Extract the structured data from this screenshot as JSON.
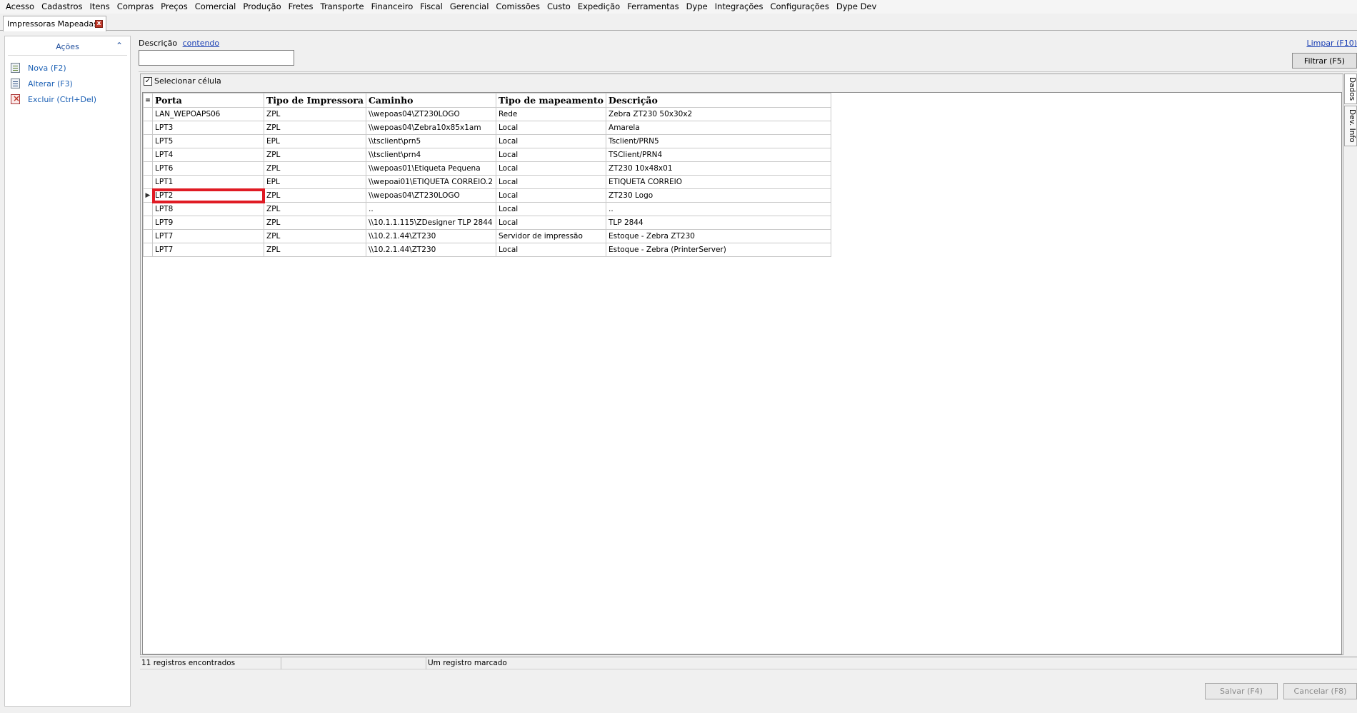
{
  "menu": [
    "Acesso",
    "Cadastros",
    "Itens",
    "Compras",
    "Preços",
    "Comercial",
    "Produção",
    "Fretes",
    "Transporte",
    "Financeiro",
    "Fiscal",
    "Gerencial",
    "Comissões",
    "Custo",
    "Expedição",
    "Ferramentas",
    "Dype",
    "Integrações",
    "Configurações",
    "Dype Dev"
  ],
  "tab": {
    "title": "Impressoras Mapeadas",
    "close_glyph": "x"
  },
  "actions": {
    "title": "Ações",
    "items": [
      {
        "label": "Nova (F2)",
        "icon": "new-document-icon"
      },
      {
        "label": "Alterar (F3)",
        "icon": "edit-document-icon"
      },
      {
        "label": "Excluir (Ctrl+Del)",
        "icon": "delete-document-icon"
      }
    ]
  },
  "filter": {
    "label": "Descrição",
    "mode_link": "contendo",
    "value": "",
    "clear_link": "Limpar (F10)",
    "filter_button": "Filtrar (F5)"
  },
  "grid": {
    "select_cell_label": "Selecionar célula",
    "select_cell_checked": true,
    "columns": [
      "Porta",
      "Tipo de Impressora",
      "Caminho",
      "Tipo de mapeamento",
      "Descrição"
    ],
    "rows": [
      [
        "LAN_WEPOAPS06",
        "ZPL",
        "\\\\wepoas04\\ZT230LOGO",
        "Rede",
        "Zebra ZT230 50x30x2"
      ],
      [
        "LPT3",
        "ZPL",
        "\\\\wepoas04\\Zebra10x85x1am",
        "Local",
        "Amarela"
      ],
      [
        "LPT5",
        "EPL",
        "\\\\tsclient\\prn5",
        "Local",
        "Tsclient/PRN5"
      ],
      [
        "LPT4",
        "ZPL",
        "\\\\tsclient\\prn4",
        "Local",
        "TSClient/PRN4"
      ],
      [
        "LPT6",
        "ZPL",
        "\\\\wepoas01\\Etiqueta Pequena",
        "Local",
        "ZT230 10x48x01"
      ],
      [
        "LPT1",
        "EPL",
        "\\\\wepoai01\\ETIQUETA CORREIO.2",
        "Local",
        "ETIQUETA CORREIO"
      ],
      [
        "LPT2",
        "ZPL",
        "\\\\wepoas04\\ZT230LOGO",
        "Local",
        "ZT230 Logo"
      ],
      [
        "LPT8",
        "ZPL",
        "..",
        "Local",
        ".."
      ],
      [
        "LPT9",
        "ZPL",
        "\\\\10.1.1.115\\ZDesigner TLP 2844",
        "Local",
        "TLP 2844"
      ],
      [
        "LPT7",
        "ZPL",
        "\\\\10.2.1.44\\ZT230",
        "Servidor de impressão",
        "Estoque - Zebra ZT230"
      ],
      [
        "LPT7",
        "ZPL",
        "\\\\10.2.1.44\\ZT230",
        "Local",
        "Estoque  - Zebra (PrinterServer)"
      ]
    ],
    "focused_row": 6,
    "highlight_color": "#e01b24"
  },
  "side_tabs": [
    "Dados",
    "Dev. Info"
  ],
  "status": {
    "count": "11 registros encontrados",
    "middle": "",
    "marked": "Um registro marcado"
  },
  "buttons": {
    "save": "Salvar (F4)",
    "cancel": "Cancelar (F8)"
  }
}
